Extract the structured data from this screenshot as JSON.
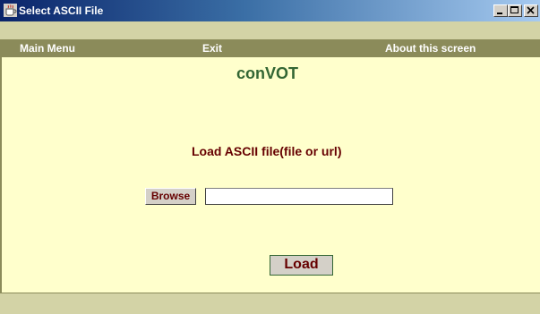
{
  "window": {
    "title": "Select ASCII File",
    "controls": [
      "minimize-icon",
      "maximize-icon",
      "close-icon"
    ]
  },
  "menu": {
    "items": [
      {
        "label": "Main Menu"
      },
      {
        "label": "Exit"
      },
      {
        "label": "About this screen"
      }
    ]
  },
  "main": {
    "app_title": "conVOT",
    "load_label": "Load ASCII file(file or url)",
    "browse_label": "Browse",
    "file_value": "",
    "load_button": "Load"
  },
  "colors": {
    "menubar": "#8b8b5a",
    "content_bg": "#ffffcc",
    "strip_bg": "#d3d3a6",
    "title_green": "#336633",
    "label_maroon": "#660000"
  }
}
